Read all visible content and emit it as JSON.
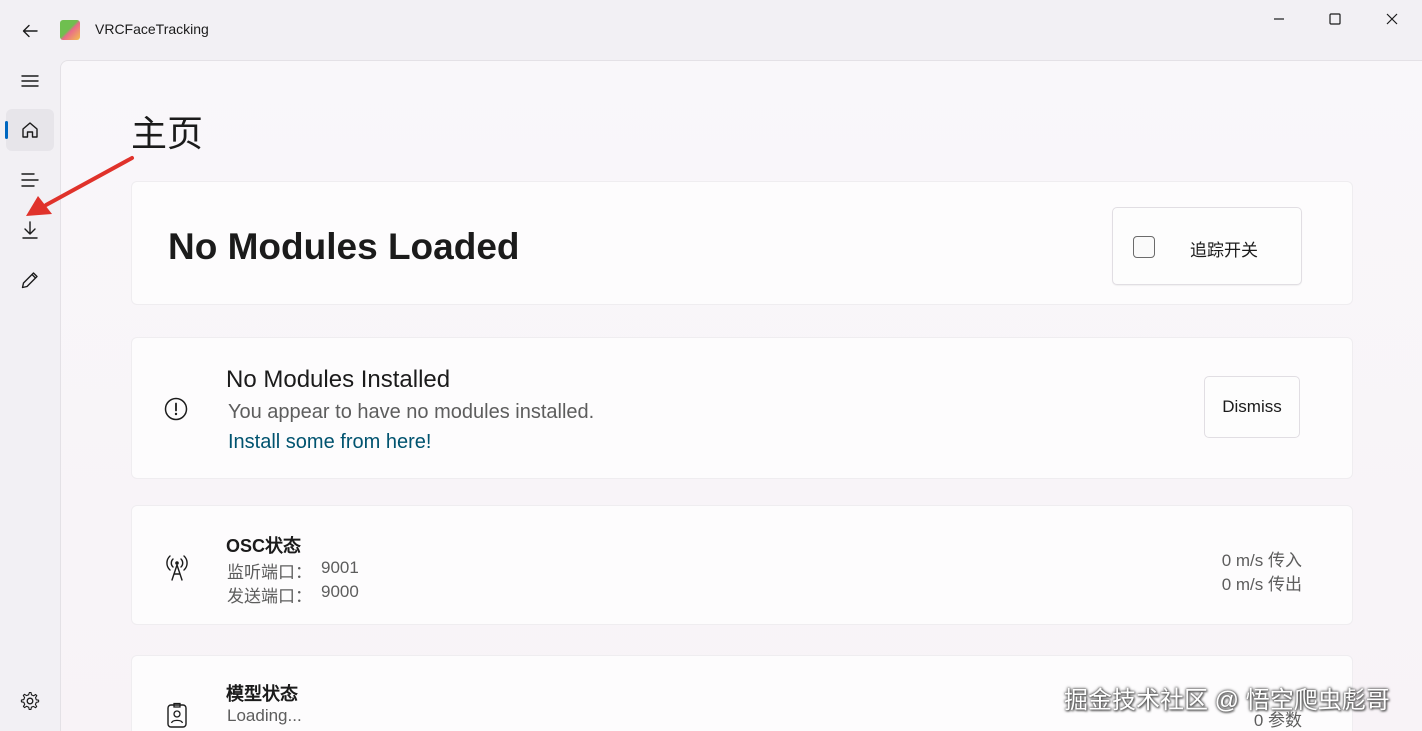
{
  "app": {
    "title": "VRCFaceTracking"
  },
  "titlebar": {
    "icons": [
      "back-arrow-icon",
      "minimize-icon",
      "maximize-icon",
      "close-icon"
    ]
  },
  "nav": {
    "items": [
      {
        "name": "hamburger-menu",
        "icon": "hamburger-icon"
      },
      {
        "name": "home",
        "icon": "home-icon",
        "selected": true
      },
      {
        "name": "list",
        "icon": "list-icon"
      },
      {
        "name": "download",
        "icon": "download-icon"
      },
      {
        "name": "edit",
        "icon": "pencil-icon"
      },
      {
        "name": "settings",
        "icon": "gear-icon"
      }
    ],
    "accent": "#0067c0"
  },
  "page": {
    "title": "主页"
  },
  "tracking": {
    "status_title": "No Modules Loaded",
    "toggle_label": "追踪开关",
    "toggle_checked": false
  },
  "notice": {
    "title": "No Modules Installed",
    "message": "You appear to have no modules installed.",
    "link": "Install some from here!",
    "dismiss_label": "Dismiss",
    "link_color": "#00536f"
  },
  "osc": {
    "title": "OSC状态",
    "listen_label": "监听端口：",
    "listen_port": "9001",
    "send_label": "发送端口：",
    "send_port": "9000",
    "in_rate": "0 m/s 传入",
    "out_rate": "0 m/s 传出"
  },
  "model": {
    "title": "模型状态",
    "status": "Loading...",
    "params": "0 参数"
  },
  "watermark": "掘金技术社区 @ 悟空爬虫彪哥",
  "annotation": {
    "color": "#e0322b"
  }
}
